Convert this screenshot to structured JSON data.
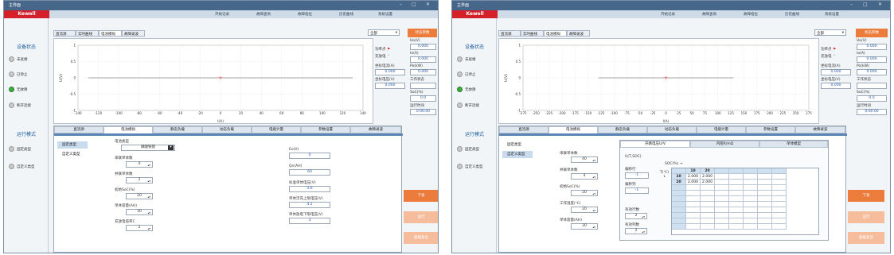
{
  "window": {
    "title": "主界面",
    "brand": "Kewell",
    "minimize": "–",
    "maximize": "□",
    "close": "✕"
  },
  "menu": [
    "开始记录",
    "故障查询",
    "故障指位",
    "历史曲线",
    "系统设置"
  ],
  "sidebar": {
    "device_state_title": "设备状态",
    "states": [
      {
        "label": "未就绪",
        "active": false
      },
      {
        "label": "已停止",
        "active": false
      },
      {
        "label": "无故障",
        "active": true
      },
      {
        "label": "断开连接",
        "active": false
      }
    ],
    "run_mode_title": "运行模式",
    "modes": [
      "固定类型",
      "自定义类型"
    ]
  },
  "top_tabs": [
    "直流源",
    "实时曲线",
    "电池模拟",
    "故障录波"
  ],
  "active_top_tab": "电池模拟",
  "mode_select": "全部",
  "status_button": "状态参数",
  "chart_data": {
    "type": "line",
    "xlabel": "I(A)",
    "ylabel": "U(V)",
    "x_ticks_left": [
      "-140",
      "-120",
      "-100",
      "-80",
      "-60",
      "-40",
      "-20",
      "0",
      "20",
      "40",
      "60",
      "80",
      "100",
      "120",
      "140"
    ],
    "x_ticks_right": [
      "-275",
      "-250",
      "-225",
      "-200",
      "-175",
      "-150",
      "-125",
      "-100",
      "-75",
      "-50",
      "-25",
      "0",
      "25",
      "50",
      "75",
      "100",
      "125",
      "150",
      "175",
      "200",
      "225",
      "250",
      "275"
    ],
    "y_ticks": [
      "1",
      "0.5",
      "0",
      "-0.5",
      "-1"
    ],
    "xlim_left": [
      -140,
      140
    ],
    "xlim_right": [
      -275,
      275
    ],
    "ylim": [
      -1,
      1
    ],
    "series": [
      {
        "points": [
          [
            -130,
            0
          ],
          [
            130,
            0
          ]
        ]
      }
    ],
    "marker": [
      0,
      0
    ]
  },
  "chart_side": {
    "func_point": "功率点",
    "charge_discharge": "充放电",
    "coord_current_label": "坐标电流(A)",
    "coord_current": "0.000",
    "coord_voltage_label": "坐标电压(V)",
    "coord_voltage": "0.000"
  },
  "status_params": [
    {
      "label": "Uo(V)",
      "value": "0.000"
    },
    {
      "label": "Io(A)",
      "value": "0.000"
    },
    {
      "label": "Po(kW)",
      "value": "0.000"
    },
    {
      "label": "工作状态",
      "value": ""
    },
    {
      "label": "SoC(%)",
      "value": "0.0"
    },
    {
      "label": "运行时间",
      "value": "0:00:00"
    }
  ],
  "bottom_tabs": [
    "直流源",
    "电池模拟",
    "静态负载",
    "动态负载",
    "电能计量",
    "参数设置",
    "故障录波"
  ],
  "active_bottom_tab": "电池模拟",
  "battery_types": [
    "固定类型",
    "自定义类型"
  ],
  "left_form": {
    "battery_type_label": "电池类型",
    "battery_type": "磷酸铁锂",
    "series_label": "串联单体数",
    "series": "0",
    "parallel_label": "并联单体数",
    "parallel": "2",
    "init_soc_label": "初始SoC(%)",
    "init_soc": "20",
    "cell_capacity_label": "单体容量(AH)",
    "cell_capacity": "30",
    "charge_rate_label": "充放电倍率C",
    "charge_rate": "2"
  },
  "left_readout": [
    {
      "label": "Eo(V)",
      "value": "0"
    },
    {
      "label": "Qn(AH)",
      "value": "60"
    },
    {
      "label": "标准单体电压(V)",
      "value": "3.6"
    },
    {
      "label": "单体浮充上限电压(V)",
      "value": "4.2"
    },
    {
      "label": "单体放电下限电压(V)",
      "value": "3"
    }
  ],
  "right_form": {
    "series_label": "串联单体数",
    "series": "40",
    "parallel_label": "并联单体数",
    "parallel": "4",
    "init_soc_label": "初始SoC(%)",
    "init_soc": "20",
    "temp_label": "工作温度(℃)",
    "temp": "20",
    "cell_capacity_label": "单体容量(AH)",
    "cell_capacity": "30"
  },
  "ocv_panel": {
    "tabs": [
      "开路电压U/V",
      "内阻R/mΩ",
      "单体模型"
    ],
    "func_label": "U(T,SOC)",
    "row_offset_label": "偏移行",
    "row_offset": "-1",
    "col_offset_label": "偏移列",
    "col_offset": "-1",
    "valid_rows_label": "有效行数",
    "valid_rows": "2",
    "valid_cols_label": "有效列数",
    "valid_cols": "2",
    "soc_axis": "SOC(%)",
    "t_axis": "T(℃)",
    "col_headers": [
      "10",
      "20"
    ],
    "rows": [
      {
        "t": "10",
        "vals": [
          "2.000",
          "2.000"
        ]
      },
      {
        "t": "20",
        "vals": [
          "2.000",
          "2.000"
        ]
      }
    ]
  },
  "actions": {
    "issue": "下发",
    "run": "运行",
    "stop": "超载复合"
  }
}
